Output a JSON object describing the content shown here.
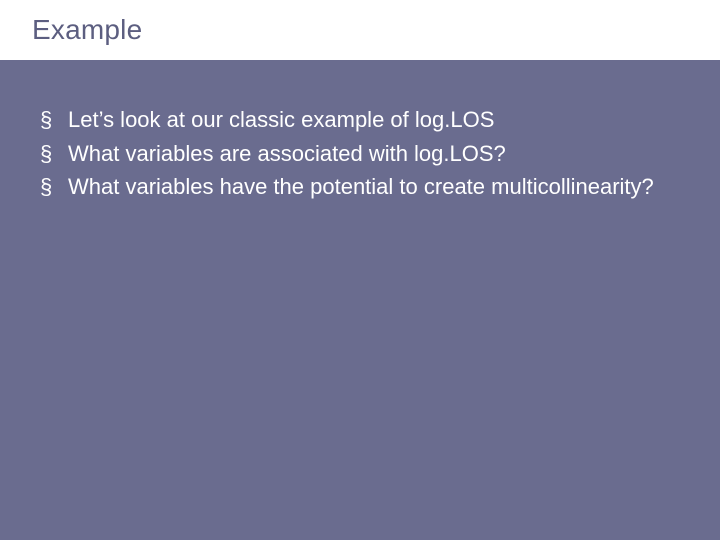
{
  "slide": {
    "title": "Example",
    "bullets": [
      "Let’s look at our classic example of log.LOS",
      "What variables are associated with log.LOS?",
      "What variables have the potential to create multicollinearity?"
    ]
  }
}
